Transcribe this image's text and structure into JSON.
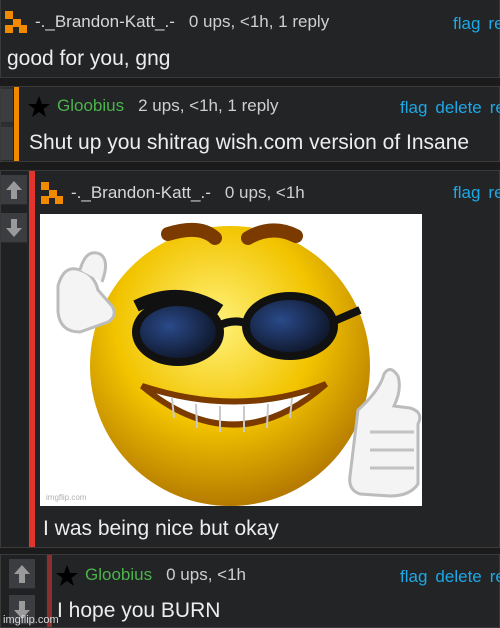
{
  "comments": [
    {
      "user": "-._Brandon-Katt_.-",
      "stats": "0 ups, <1h, 1 reply",
      "actions": [
        "flag",
        "re"
      ],
      "text": "good for you, gng"
    },
    {
      "user": "Gloobius",
      "stats": "2 ups, <1h, 1 reply",
      "actions": [
        "flag",
        "delete",
        "re"
      ],
      "text": "Shut up you shitrag wish.com version of Insane"
    },
    {
      "user": "-._Brandon-Katt_.-",
      "stats": "0 ups, <1h",
      "actions": [
        "flag",
        "re"
      ],
      "text": "I was being nice but okay",
      "image_watermark": "imgflip.com"
    },
    {
      "user": "Gloobius",
      "stats": "0 ups, <1h",
      "actions": [
        "flag",
        "delete",
        "re"
      ],
      "text": "I hope you BURN"
    }
  ],
  "colors": {
    "orange_bar": "#f28a00",
    "red_bar": "#e0342c",
    "link": "#1ea8e6",
    "username_green": "#4cb34c"
  },
  "icons": {
    "orange_avatar": "orange-pixel-avatar-icon",
    "star_avatar": "black-star-icon",
    "up_vote": "arrow-up-icon",
    "down_vote": "arrow-down-icon"
  },
  "footer_watermark": "imgflip.com"
}
